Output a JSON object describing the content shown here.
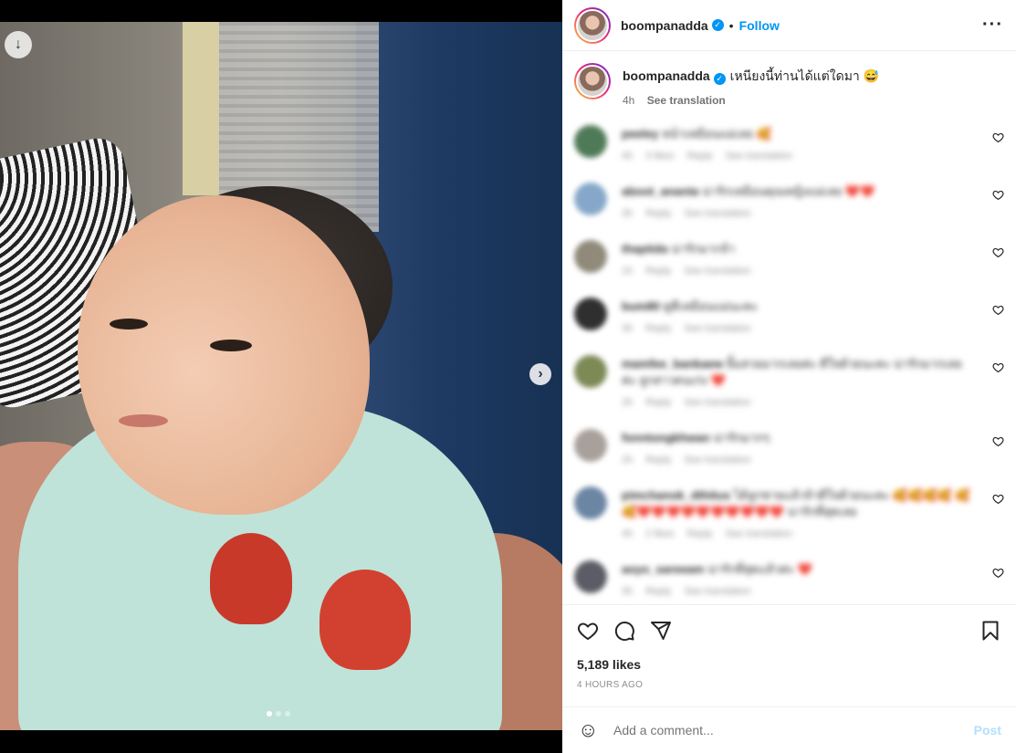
{
  "header": {
    "username": "boompanadda",
    "separator": "•",
    "follow_label": "Follow",
    "more_label": "···"
  },
  "caption": {
    "username": "boompanadda",
    "text": "เหนียงนี้ท่านได้แต่ใดมา 😅",
    "age": "4h",
    "see_translation": "See translation"
  },
  "media": {
    "download_icon": "↓",
    "next_icon": "›",
    "carousel_dots": 3,
    "active_dot": 1
  },
  "comments": [
    {
      "username": "peeley",
      "text": "หน้าเหมือนแม่เลย 🥰",
      "age": "4h",
      "likes": "3 likes",
      "reply": "Reply",
      "translate": "See translation",
      "avatar_color": "#4f7a57"
    },
    {
      "username": "aboot_ananta",
      "text": "น่ารักเหมือนคุณหญิงแม่เลย ❤️❤️",
      "age": "3h",
      "reply": "Reply",
      "translate": "See translation",
      "avatar_color": "#86a7c9"
    },
    {
      "username": "thaptida",
      "text": "น่ารักมากจ้า",
      "age": "1h",
      "reply": "Reply",
      "translate": "See translation",
      "avatar_color": "#8f8a7a"
    },
    {
      "username": "bum80",
      "text": "ดูดีเหมือนแม่นะคะ",
      "age": "3h",
      "reply": "Reply",
      "translate": "See translation",
      "avatar_color": "#2f2f2f"
    },
    {
      "username": "mamfee_bankaew",
      "text": "ยิ้มสวยมากเลยค่ะ ดีใจด้วยนะคะ น่ารักมากเลยค่ะ ลูกสาวคนเก่ง ❤️",
      "age": "2h",
      "reply": "Reply",
      "translate": "See translation",
      "avatar_color": "#7d8a56"
    },
    {
      "username": "fonntongkhwan",
      "text": "น่ารักมากๆ",
      "age": "2h",
      "reply": "Reply",
      "translate": "See translation",
      "avatar_color": "#a8a09a"
    },
    {
      "username": "pimchanok_dthitus",
      "text": "ได้ลูกชายแล้วจ้าดีใจด้วยนะคะ 🥰🥰🥰🥰 🥰🥰❤️❤️❤️❤️❤️❤️❤️❤️❤️❤️ น่ารักที่สุดเลย",
      "age": "4h",
      "likes": "2 likes",
      "reply": "Reply",
      "translate": "See translation",
      "avatar_color": "#6b86a3"
    },
    {
      "username": "aoyo_sareeam",
      "text": "น่ารักที่สุดแล้วค่ะ ❤️",
      "age": "3h",
      "reply": "Reply",
      "translate": "See translation",
      "avatar_color": "#5c5c66"
    }
  ],
  "actions": {
    "likes_count": "5,189 likes",
    "time_ago": "4 HOURS AGO"
  },
  "add_comment": {
    "emoji_icon": "☺",
    "placeholder": "Add a comment...",
    "post_label": "Post"
  }
}
